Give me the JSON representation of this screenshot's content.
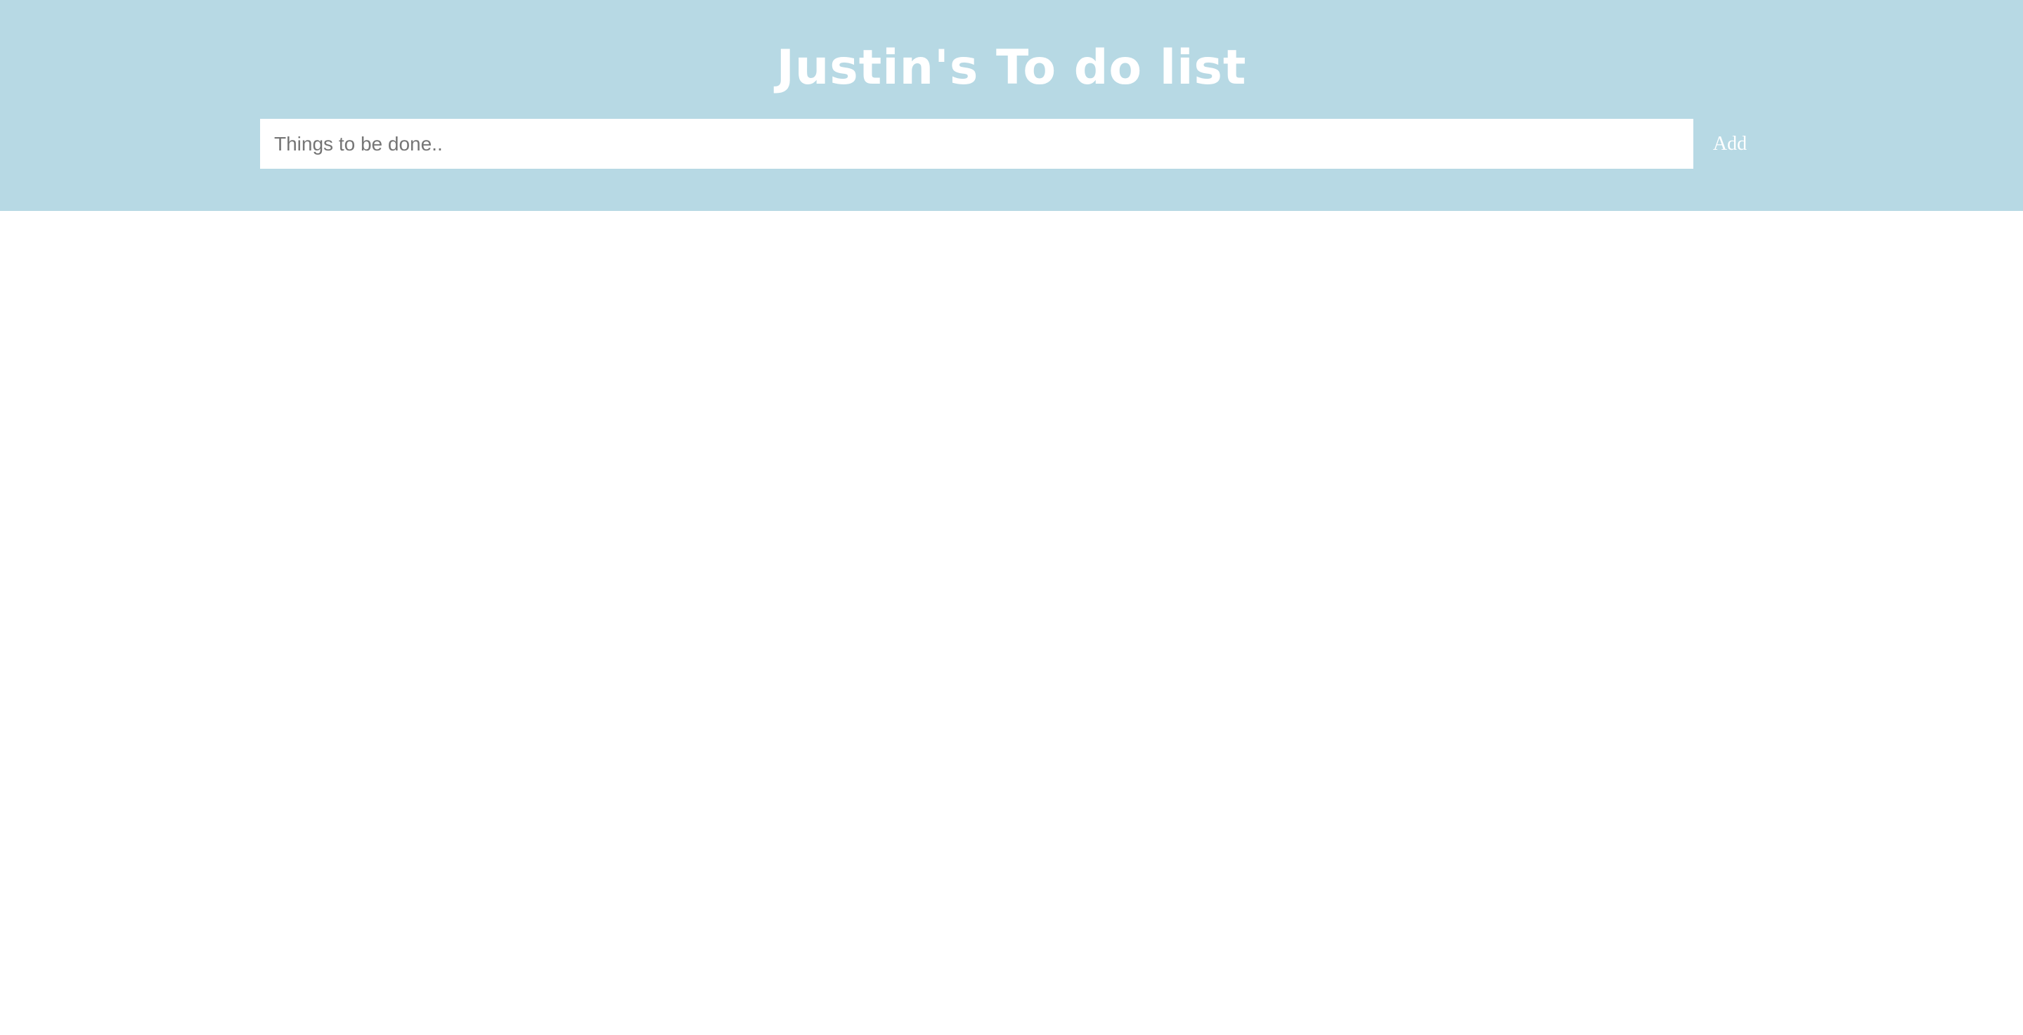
{
  "header": {
    "title": "Justin's To do list",
    "background_color": "#b7d9e4"
  },
  "todo_form": {
    "input_placeholder": "Things to be done..",
    "input_value": "",
    "add_label": "Add"
  }
}
